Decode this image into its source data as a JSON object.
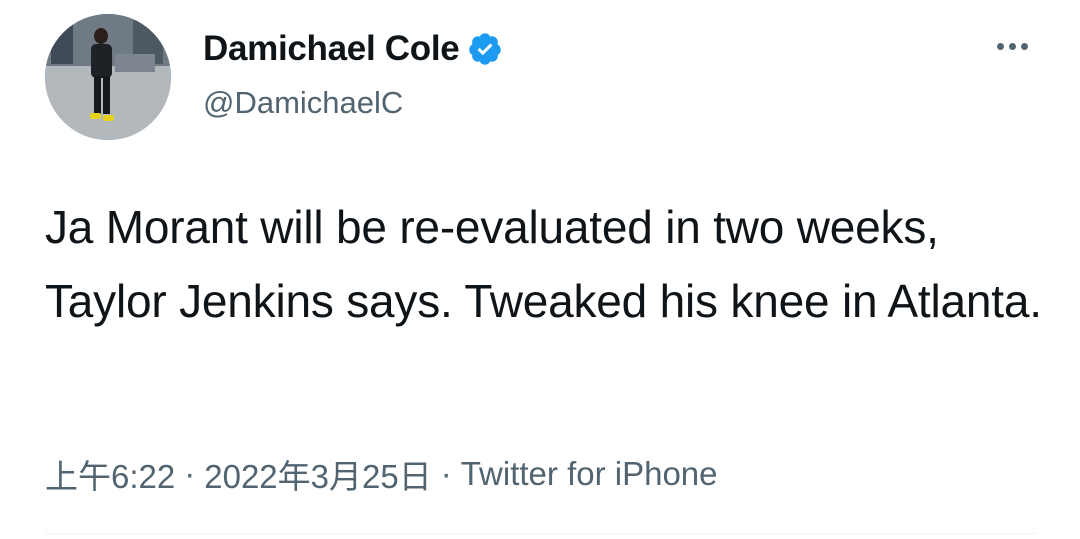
{
  "tweet": {
    "author": {
      "display_name": "Damichael Cole",
      "handle": "@DamichaelC",
      "verified": true,
      "avatar_icon": "profile-photo-person-standing"
    },
    "more_icon": "more-horizontal-icon",
    "text": "Ja Morant will be re-evaluated in two weeks, Taylor Jenkins says. Tweaked his knee in Atlanta.",
    "time": "上午6:22",
    "date": "2022年3月25日",
    "separator": "·",
    "source": "Twitter for iPhone"
  },
  "colors": {
    "text": "#0f1419",
    "secondary": "#536471",
    "verified": "#1d9bf0",
    "divider": "#eff3f4"
  }
}
